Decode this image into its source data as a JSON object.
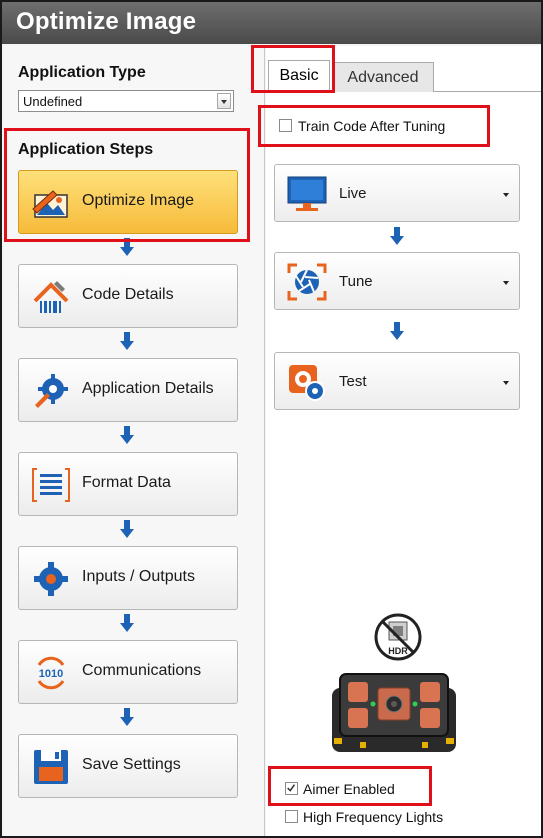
{
  "window": {
    "title": "Optimize Image"
  },
  "left": {
    "app_type_label": "Application Type",
    "app_type_value": "Undefined",
    "steps_label": "Application Steps",
    "steps": [
      {
        "label": "Optimize Image",
        "icon": "optimize-image-icon"
      },
      {
        "label": "Code Details",
        "icon": "code-details-icon"
      },
      {
        "label": "Application Details",
        "icon": "application-details-icon"
      },
      {
        "label": "Format Data",
        "icon": "format-data-icon"
      },
      {
        "label": "Inputs / Outputs",
        "icon": "inputs-outputs-icon"
      },
      {
        "label": "Communications",
        "icon": "communications-icon"
      },
      {
        "label": "Save Settings",
        "icon": "save-settings-icon"
      }
    ]
  },
  "tabs": {
    "basic": "Basic",
    "advanced": "Advanced"
  },
  "right": {
    "train_code_label": "Train Code After Tuning",
    "train_code_checked": false,
    "actions": [
      {
        "label": "Live",
        "icon": "monitor-icon"
      },
      {
        "label": "Tune",
        "icon": "tune-aperture-icon"
      },
      {
        "label": "Test",
        "icon": "test-gear-icon"
      }
    ],
    "hdr_badge": "HDR",
    "aimer_label": "Aimer Enabled",
    "aimer_checked": true,
    "hf_lights_label": "High Frequency Lights",
    "hf_lights_checked": false
  },
  "colors": {
    "active_step": "#f6bb3a",
    "arrow_blue": "#1e62b6",
    "icon_orange": "#e8641e",
    "highlight_red": "#e0101a"
  }
}
